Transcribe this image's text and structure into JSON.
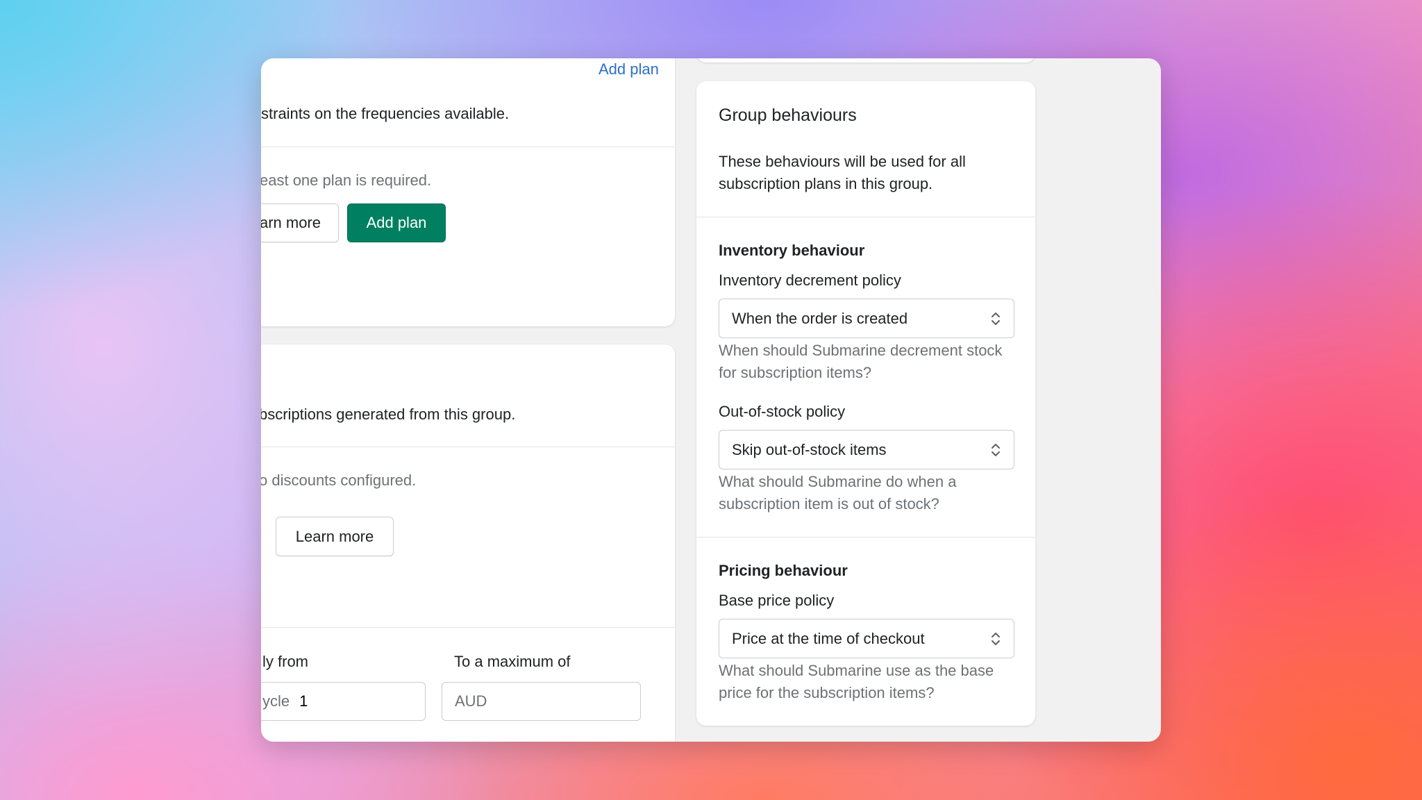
{
  "plans_card": {
    "add_plan_link": "Add plan",
    "description_fragment": "straints on the frequencies available.",
    "empty_text_fragment": "east one plan is required.",
    "learn_more_fragment": "arn more",
    "add_plan_button": "Add plan"
  },
  "discounts_card": {
    "description_fragment": "bscriptions generated from this group.",
    "empty_text_fragment": "o discounts configured.",
    "learn_more_button": "Learn more",
    "apply_from_label_fragment": "ly from",
    "apply_from_unit_fragment": "ycle",
    "apply_from_value": "1",
    "max_label": "To a maximum of",
    "max_placeholder": "AUD"
  },
  "group_behaviours": {
    "title": "Group behaviours",
    "description": "These behaviours will be used for all subscription plans in this group.",
    "inventory": {
      "heading": "Inventory behaviour",
      "decrement_label": "Inventory decrement policy",
      "decrement_value": "When the order is created",
      "decrement_help": "When should Submarine decrement stock for subscription items?",
      "oos_label": "Out-of-stock policy",
      "oos_value": "Skip out-of-stock items",
      "oos_help": "What should Submarine do when a subscription item is out of stock?"
    },
    "pricing": {
      "heading": "Pricing behaviour",
      "base_label": "Base price policy",
      "base_value": "Price at the time of checkout",
      "base_help": "What should Submarine use as the base price for the subscription items?"
    }
  },
  "icons": {
    "select_chevron": "chevron-up-down-icon"
  }
}
